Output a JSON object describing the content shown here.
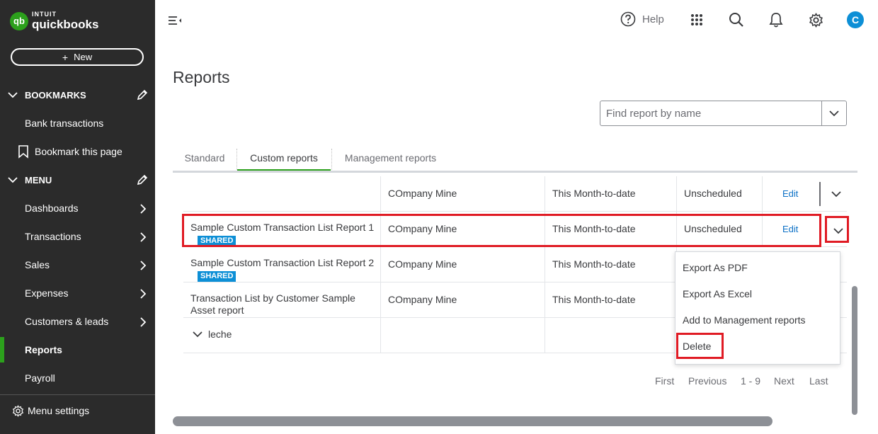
{
  "brand": {
    "intuit": "INTUIT",
    "name": "quickbooks",
    "mark": "qb"
  },
  "colors": {
    "brand_green": "#2ca01c",
    "sidebar_bg": "#2b2b2b",
    "link_blue": "#0d71c6",
    "badge_blue": "#0d8fd6",
    "highlight_red": "#e01b24"
  },
  "sidebar": {
    "new_button": {
      "plus": "+",
      "label": "New"
    },
    "bookmarks": {
      "heading": "BOOKMARKS",
      "items": [
        {
          "label": "Bank transactions"
        },
        {
          "label": "Bookmark this page"
        }
      ]
    },
    "menu": {
      "heading": "MENU",
      "items": [
        {
          "label": "Dashboards"
        },
        {
          "label": "Transactions"
        },
        {
          "label": "Sales"
        },
        {
          "label": "Expenses"
        },
        {
          "label": "Customers & leads"
        },
        {
          "label": "Reports"
        },
        {
          "label": "Payroll"
        }
      ]
    },
    "menu_settings": "Menu settings"
  },
  "topbar": {
    "help_label": "Help",
    "avatar_initial": "C"
  },
  "page": {
    "title": "Reports",
    "search_placeholder": "Find report by name",
    "tabs": [
      {
        "label": "Standard"
      },
      {
        "label": "Custom reports"
      },
      {
        "label": "Management reports"
      }
    ],
    "active_tab": "Custom reports"
  },
  "table": {
    "rows": [
      {
        "name": "",
        "created_by": "COmpany Mine",
        "date_range": "This Month-to-date",
        "schedule": "Unscheduled",
        "action": "Edit"
      },
      {
        "name": "Sample Custom Transaction List Report 1",
        "badge": "SHARED",
        "created_by": "COmpany Mine",
        "date_range": "This Month-to-date",
        "schedule": "Unscheduled",
        "action": "Edit"
      },
      {
        "name": "Sample Custom Transaction List Report 2",
        "badge": "SHARED",
        "created_by": "COmpany Mine",
        "date_range": "This Month-to-date"
      },
      {
        "name": "Transaction List by Customer Sample Asset report",
        "created_by": "COmpany Mine",
        "date_range": "This Month-to-date"
      }
    ],
    "group": {
      "label": "leche"
    }
  },
  "dropdown_menu": {
    "items": [
      {
        "label": "Export As PDF"
      },
      {
        "label": "Export As Excel"
      },
      {
        "label": "Add to Management reports"
      },
      {
        "label": "Delete"
      }
    ]
  },
  "pagination": {
    "first": "First",
    "previous": "Previous",
    "range": "1 - 9",
    "next": "Next",
    "last": "Last"
  }
}
